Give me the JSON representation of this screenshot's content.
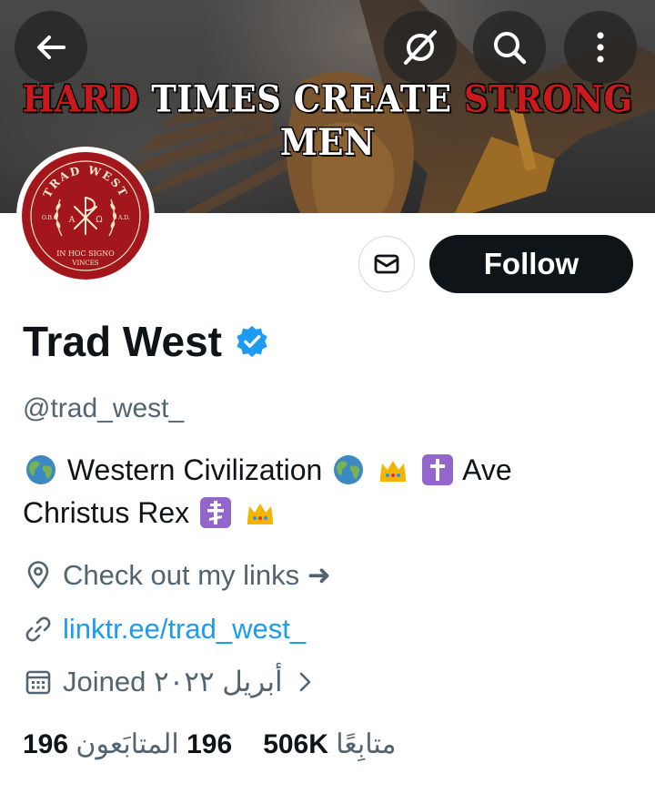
{
  "banner": {
    "text_part1": "HARD",
    "text_part2": " TIMES CREATE ",
    "text_part3": "STRONG",
    "text_part4": " MEN",
    "accent_red": "#c9191c"
  },
  "top_bar": {
    "back_icon": "arrow-left-icon",
    "grok_icon": "grok-icon",
    "search_icon": "search-icon",
    "more_icon": "more-vertical-icon"
  },
  "avatar": {
    "ring_top": "TRAD WEST",
    "left_tag": "O.B.C",
    "right_tag": "A.D.",
    "motto_line1": "IN HOC SIGNO",
    "motto_line2": "VINCES",
    "color": "#a3171c"
  },
  "actions": {
    "message_icon": "envelope-icon",
    "follow_label": "Follow"
  },
  "profile": {
    "name": "Trad West",
    "verified_icon": "verified-badge-icon",
    "handle": "@trad_west_",
    "bio_part1": "Western Civilization",
    "bio_part2": "Ave",
    "bio_part3": "Christus Rex",
    "bio_emojis": [
      "globe-emoji",
      "globe-emoji",
      "crown-emoji",
      "latin-cross-emoji",
      "orthodox-cross-emoji",
      "crown-emoji"
    ],
    "location_icon": "location-pin-icon",
    "location": "Check out my links ➜",
    "link_icon": "link-icon",
    "link": "linktr.ee/trad_west_",
    "joined_icon": "calendar-icon",
    "joined_label": "Joined",
    "joined_date": "أبريل ٢٠٢٢",
    "chevron_icon": "chevron-right-icon"
  },
  "stats": {
    "followers_count": "196",
    "followers_label": "المتابَعون",
    "following_count": "506K",
    "following_label": "متابِعًا"
  },
  "colors": {
    "text": "#0f1419",
    "muted": "#536471",
    "link": "#1d9bf0",
    "verified": "#1d9bf0"
  }
}
